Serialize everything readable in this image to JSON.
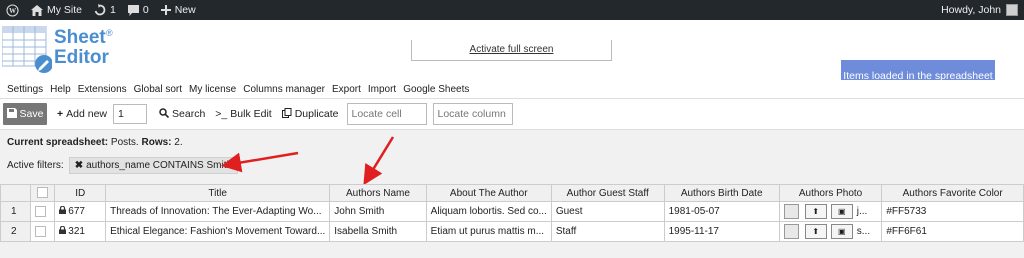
{
  "adminbar": {
    "site_label": "My Site",
    "updates_count": "1",
    "comments_count": "0",
    "new_label": "New",
    "greeting": "Howdy, John"
  },
  "logo": {
    "line1": "Sheet",
    "line2": "Editor",
    "registered": "®"
  },
  "header": {
    "fullscreen_link": "Activate full screen",
    "items_loaded": "Items loaded in the spreadsheet"
  },
  "menu": [
    "Settings",
    "Help",
    "Extensions",
    "Global sort",
    "My license",
    "Columns manager",
    "Export",
    "Import",
    "Google Sheets"
  ],
  "toolbar": {
    "save_label": "Save",
    "add_new_label": "Add new",
    "add_new_count": "1",
    "search_label": "Search",
    "bulk_edit_label": "Bulk Edit",
    "duplicate_label": "Duplicate",
    "locate_cell_placeholder": "Locate cell",
    "locate_column_placeholder": "Locate column"
  },
  "info": {
    "current_label": "Current spreadsheet:",
    "current_value": "Posts.",
    "rows_label": "Rows:",
    "rows_value": "2."
  },
  "filters": {
    "label": "Active filters:",
    "chip": "authors_name CONTAINS Smith"
  },
  "colors": {
    "adminbar_bg": "#23282d",
    "accent_button": "#6e8cd9",
    "logo_blue": "#4a8ed0",
    "arrow_red": "#e02020"
  },
  "grid": {
    "headers": [
      "ID",
      "Title",
      "Authors Name",
      "About The Author",
      "Author Guest Staff",
      "Authors Birth Date",
      "Authors Photo",
      "Authors Favorite Color"
    ],
    "rows": [
      {
        "num": "1",
        "id": "677",
        "title": "Threads of Innovation: The Ever-Adapting Wo...",
        "author": "John Smith",
        "about": "Aliquam lobortis. Sed co...",
        "guest_staff": "Guest",
        "birth": "1981-05-07",
        "photo_text": "j...",
        "color": "#FF5733"
      },
      {
        "num": "2",
        "id": "321",
        "title": "Ethical Elegance: Fashion's Movement Toward...",
        "author": "Isabella Smith",
        "about": "Etiam ut purus mattis m...",
        "guest_staff": "Staff",
        "birth": "1995-11-17",
        "photo_text": "s...",
        "color": "#FF6F61"
      }
    ]
  }
}
